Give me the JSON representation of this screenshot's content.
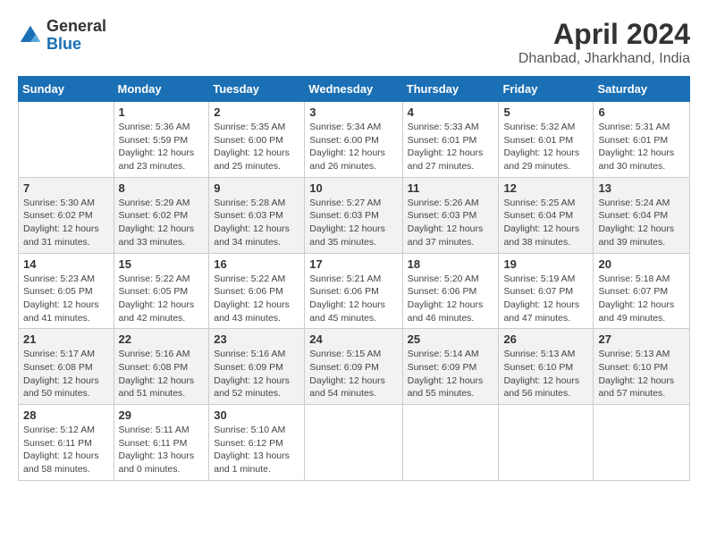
{
  "logo": {
    "general": "General",
    "blue": "Blue"
  },
  "title": {
    "month_year": "April 2024",
    "location": "Dhanbad, Jharkhand, India"
  },
  "days_of_week": [
    "Sunday",
    "Monday",
    "Tuesday",
    "Wednesday",
    "Thursday",
    "Friday",
    "Saturday"
  ],
  "weeks": [
    [
      {
        "num": "",
        "info": ""
      },
      {
        "num": "1",
        "info": "Sunrise: 5:36 AM\nSunset: 5:59 PM\nDaylight: 12 hours\nand 23 minutes."
      },
      {
        "num": "2",
        "info": "Sunrise: 5:35 AM\nSunset: 6:00 PM\nDaylight: 12 hours\nand 25 minutes."
      },
      {
        "num": "3",
        "info": "Sunrise: 5:34 AM\nSunset: 6:00 PM\nDaylight: 12 hours\nand 26 minutes."
      },
      {
        "num": "4",
        "info": "Sunrise: 5:33 AM\nSunset: 6:01 PM\nDaylight: 12 hours\nand 27 minutes."
      },
      {
        "num": "5",
        "info": "Sunrise: 5:32 AM\nSunset: 6:01 PM\nDaylight: 12 hours\nand 29 minutes."
      },
      {
        "num": "6",
        "info": "Sunrise: 5:31 AM\nSunset: 6:01 PM\nDaylight: 12 hours\nand 30 minutes."
      }
    ],
    [
      {
        "num": "7",
        "info": "Sunrise: 5:30 AM\nSunset: 6:02 PM\nDaylight: 12 hours\nand 31 minutes."
      },
      {
        "num": "8",
        "info": "Sunrise: 5:29 AM\nSunset: 6:02 PM\nDaylight: 12 hours\nand 33 minutes."
      },
      {
        "num": "9",
        "info": "Sunrise: 5:28 AM\nSunset: 6:03 PM\nDaylight: 12 hours\nand 34 minutes."
      },
      {
        "num": "10",
        "info": "Sunrise: 5:27 AM\nSunset: 6:03 PM\nDaylight: 12 hours\nand 35 minutes."
      },
      {
        "num": "11",
        "info": "Sunrise: 5:26 AM\nSunset: 6:03 PM\nDaylight: 12 hours\nand 37 minutes."
      },
      {
        "num": "12",
        "info": "Sunrise: 5:25 AM\nSunset: 6:04 PM\nDaylight: 12 hours\nand 38 minutes."
      },
      {
        "num": "13",
        "info": "Sunrise: 5:24 AM\nSunset: 6:04 PM\nDaylight: 12 hours\nand 39 minutes."
      }
    ],
    [
      {
        "num": "14",
        "info": "Sunrise: 5:23 AM\nSunset: 6:05 PM\nDaylight: 12 hours\nand 41 minutes."
      },
      {
        "num": "15",
        "info": "Sunrise: 5:22 AM\nSunset: 6:05 PM\nDaylight: 12 hours\nand 42 minutes."
      },
      {
        "num": "16",
        "info": "Sunrise: 5:22 AM\nSunset: 6:06 PM\nDaylight: 12 hours\nand 43 minutes."
      },
      {
        "num": "17",
        "info": "Sunrise: 5:21 AM\nSunset: 6:06 PM\nDaylight: 12 hours\nand 45 minutes."
      },
      {
        "num": "18",
        "info": "Sunrise: 5:20 AM\nSunset: 6:06 PM\nDaylight: 12 hours\nand 46 minutes."
      },
      {
        "num": "19",
        "info": "Sunrise: 5:19 AM\nSunset: 6:07 PM\nDaylight: 12 hours\nand 47 minutes."
      },
      {
        "num": "20",
        "info": "Sunrise: 5:18 AM\nSunset: 6:07 PM\nDaylight: 12 hours\nand 49 minutes."
      }
    ],
    [
      {
        "num": "21",
        "info": "Sunrise: 5:17 AM\nSunset: 6:08 PM\nDaylight: 12 hours\nand 50 minutes."
      },
      {
        "num": "22",
        "info": "Sunrise: 5:16 AM\nSunset: 6:08 PM\nDaylight: 12 hours\nand 51 minutes."
      },
      {
        "num": "23",
        "info": "Sunrise: 5:16 AM\nSunset: 6:09 PM\nDaylight: 12 hours\nand 52 minutes."
      },
      {
        "num": "24",
        "info": "Sunrise: 5:15 AM\nSunset: 6:09 PM\nDaylight: 12 hours\nand 54 minutes."
      },
      {
        "num": "25",
        "info": "Sunrise: 5:14 AM\nSunset: 6:09 PM\nDaylight: 12 hours\nand 55 minutes."
      },
      {
        "num": "26",
        "info": "Sunrise: 5:13 AM\nSunset: 6:10 PM\nDaylight: 12 hours\nand 56 minutes."
      },
      {
        "num": "27",
        "info": "Sunrise: 5:13 AM\nSunset: 6:10 PM\nDaylight: 12 hours\nand 57 minutes."
      }
    ],
    [
      {
        "num": "28",
        "info": "Sunrise: 5:12 AM\nSunset: 6:11 PM\nDaylight: 12 hours\nand 58 minutes."
      },
      {
        "num": "29",
        "info": "Sunrise: 5:11 AM\nSunset: 6:11 PM\nDaylight: 13 hours\nand 0 minutes."
      },
      {
        "num": "30",
        "info": "Sunrise: 5:10 AM\nSunset: 6:12 PM\nDaylight: 13 hours\nand 1 minute."
      },
      {
        "num": "",
        "info": ""
      },
      {
        "num": "",
        "info": ""
      },
      {
        "num": "",
        "info": ""
      },
      {
        "num": "",
        "info": ""
      }
    ]
  ]
}
